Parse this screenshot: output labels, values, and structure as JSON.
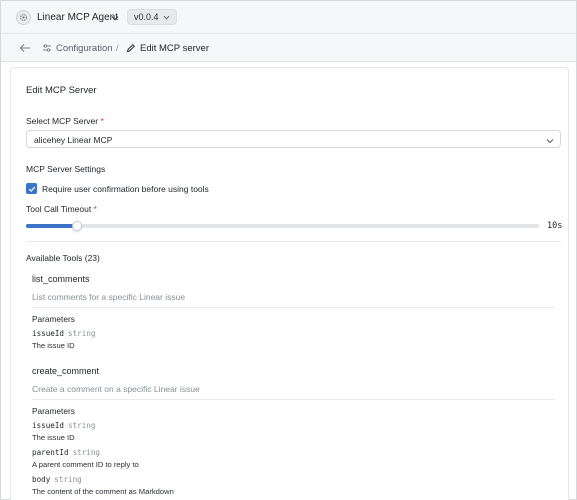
{
  "app": {
    "title": "Linear MCP Agent",
    "version": "v0.0.4",
    "icon": "gear-icon"
  },
  "breadcrumb": {
    "parent": "Configuration",
    "separator": "/",
    "current": "Edit MCP server"
  },
  "form": {
    "heading": "Edit MCP Server",
    "server_select": {
      "label": "Select MCP Server",
      "required_mark": "*",
      "value": "alicehey Linear MCP"
    },
    "settings_heading": "MCP Server Settings",
    "require_confirmation": {
      "label": "Require user confirmation before using tools",
      "checked": true
    },
    "timeout": {
      "label": "Tool Call Timeout",
      "required_mark": "*",
      "readout": "10s",
      "fraction": 0.1
    }
  },
  "tools": {
    "heading": "Available Tools (23)",
    "items": [
      {
        "name": "list_comments",
        "description": "List comments for a specific Linear issue",
        "parameters_label": "Parameters",
        "params": [
          {
            "name": "issueId",
            "type": "string",
            "description": "The issue ID"
          }
        ]
      },
      {
        "name": "create_comment",
        "description": "Create a comment on a specific Linear issue",
        "parameters_label": "Parameters",
        "params": [
          {
            "name": "issueId",
            "type": "string",
            "description": "The issue ID"
          },
          {
            "name": "parentId",
            "type": "string",
            "description": "A parent comment ID to reply to"
          },
          {
            "name": "body",
            "type": "string",
            "description": "The content of the comment as Markdown"
          }
        ]
      }
    ]
  },
  "colors": {
    "accent": "#3b73c6",
    "required": "#d23b3b",
    "muted_text": "#8a9097"
  }
}
